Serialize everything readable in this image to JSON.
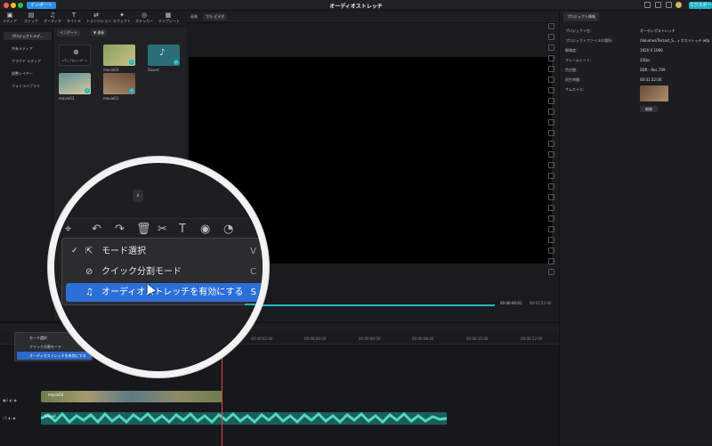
{
  "titlebar": {
    "import_tab": "インポート",
    "title": "オーディオストレッチ",
    "export_label": "エクスポート"
  },
  "toolbar": {
    "tools": [
      {
        "label": "メディア",
        "icon": "media-icon"
      },
      {
        "label": "ストック",
        "icon": "stock-icon"
      },
      {
        "label": "オーディオ",
        "icon": "audio-icon"
      },
      {
        "label": "タイトル",
        "icon": "title-icon"
      },
      {
        "label": "トランジション",
        "icon": "transition-icon"
      },
      {
        "label": "エフェクト",
        "icon": "effect-icon"
      },
      {
        "label": "ステッカー",
        "icon": "sticker-icon"
      },
      {
        "label": "テンプレート",
        "icon": "template-icon"
      }
    ]
  },
  "sidebar": {
    "items": [
      "プロジェクトメデ...",
      "共有メディア",
      "クラウド メディア",
      "調整レイヤー",
      "フォトライブラリ"
    ]
  },
  "media": {
    "import_chip": "インポート",
    "filter_chip": "▼ 最新",
    "import_media_label": "メディアのインポート",
    "clips": [
      "movie03",
      "Sound",
      "movie03",
      "movie01"
    ]
  },
  "preview": {
    "quality_label": "画質",
    "view_label": "フル ビデオ",
    "time_current": "00:00:00:01",
    "time_total": "00:01:52:00"
  },
  "panel": {
    "tab": "プロジェクト情報",
    "props": [
      {
        "k": "プロジェクト名：",
        "v": "オーディオストレッチ"
      },
      {
        "k": "プロジェクトファイルの場所：",
        "v": "/Volumes/Teclast_S...ィオストレッチ.wfp"
      },
      {
        "k": "解像度：",
        "v": "1920 X 1080"
      },
      {
        "k": "フレームレート：",
        "v": "25fps"
      },
      {
        "k": "色空間：",
        "v": "SDR - Rec.709"
      },
      {
        "k": "再生時間：",
        "v": "00:01:52:00"
      },
      {
        "k": "サムネイル：",
        "v": ""
      }
    ],
    "edit_label": "編集"
  },
  "timeline": {
    "ticks": [
      "00:00:00",
      "00:00:02:00",
      "00:00:04:00",
      "00:00:06:00",
      "00:00:08:00",
      "00:00:10:00",
      "00:00:12:00"
    ],
    "video_clip": "movie03",
    "audio_clip": "Sound"
  },
  "menu": {
    "items": [
      {
        "label": "モード選択",
        "key": "V",
        "checked": true
      },
      {
        "label": "クイック分割モード",
        "key": "C",
        "checked": false
      },
      {
        "label": "オーディオストレッチを有効にする",
        "key": "S",
        "checked": false
      }
    ]
  },
  "colors": {
    "accent": "#1fb3c8",
    "selection": "#2c6fd6",
    "playhead": "#e3434b"
  }
}
